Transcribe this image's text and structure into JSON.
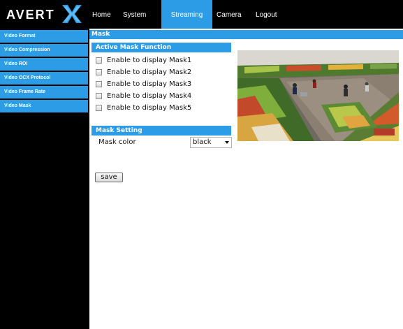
{
  "brand": {
    "logo": "AVERT"
  },
  "nav": {
    "home": "Home",
    "system": "System",
    "streaming": "Streaming",
    "camera": "Camera",
    "logout": "Logout"
  },
  "sidebar": {
    "items": [
      {
        "label": "Video Format"
      },
      {
        "label": "Video Compression"
      },
      {
        "label": "Video ROI"
      },
      {
        "label": "Video OCX Protocol"
      },
      {
        "label": "Video Frame Rate"
      },
      {
        "label": "Video Mask"
      }
    ]
  },
  "main": {
    "title": "Mask",
    "active_section": "Active Mask Function",
    "masks": [
      {
        "label": "Enable to display Mask1",
        "checked": false
      },
      {
        "label": "Enable to display Mask2",
        "checked": false
      },
      {
        "label": "Enable to display Mask3",
        "checked": false
      },
      {
        "label": "Enable to display Mask4",
        "checked": false
      },
      {
        "label": "Enable to display Mask5",
        "checked": false
      }
    ],
    "setting_section": "Mask Setting",
    "mask_color_label": "Mask color",
    "mask_color_value": "black",
    "save_label": "save"
  },
  "colors": {
    "accent": "#2d9ce6",
    "chrome": "#000000"
  }
}
